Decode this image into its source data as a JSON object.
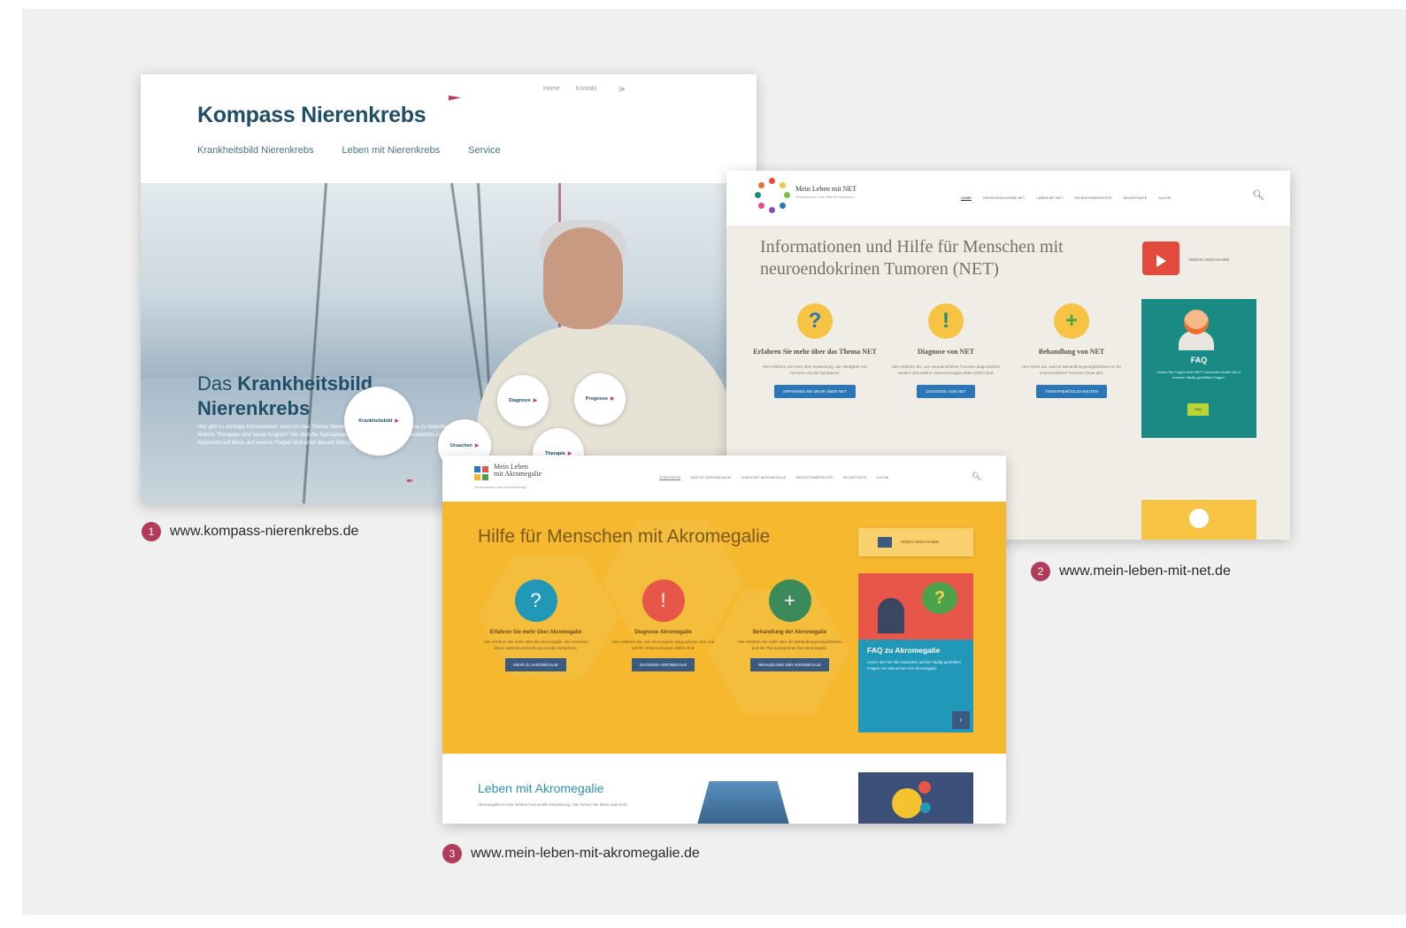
{
  "shot1": {
    "logo": "Kompass Nierenkrebs",
    "topnav": [
      "Home",
      "Kontakt"
    ],
    "mainnav": [
      "Krankheitsbild Nierenkrebs",
      "Leben mit Nierenkrebs",
      "Service"
    ],
    "headline_light": "Das",
    "headline_bold1": "Krankheitsbild",
    "headline_bold2": "Nierenkrebs",
    "lead": "Hier gibt es wichtige Informationen rund um das Thema Nierenkrebs. Was ist bei der Diagnose zu beachten? Welche Therapien sind heute möglich? Wo sind die Spezialisten für die Behandlung von Nierenkrebs zu finden? Antworten auf diese und weitere Fragen sind unter diesem Menüpunkt nachzulesen.",
    "bubbles": [
      "Krankheitsbild",
      "Diagnose",
      "Prognose",
      "Ursachen",
      "Therapie"
    ]
  },
  "shot2": {
    "logo": "Mein Leben mit NET",
    "logo_sub": "Informationen und Hilfe für Menschen",
    "nav": [
      "HOME",
      "NEUROENDOKRINE NET",
      "LEBEN MIT NET",
      "PATIENTENBERICHTE",
      "SELBSTHILFE",
      "SUCHE"
    ],
    "title": "Informationen und Hilfe für Menschen mit neuroendokrinen Tumoren (NET)",
    "video_label": "VIDEOS ANSCHAUEN",
    "columns": [
      {
        "icon": "?",
        "heading": "Erfahren Sie mehr über das Thema NET",
        "text": "Hier erfahren Sie mehr über Entstehung, die Häufigkeit von Tumoren und die Symptome.",
        "button": "ERFAHREN SIE MEHR ÜBER NET"
      },
      {
        "icon": "!",
        "heading": "Diagnose von NET",
        "text": "Hier erfahren Sie, wie neuroendokrine Tumoren diagnostiziert werden und welche Untersuchungen dabei üblich sind.",
        "button": "DIAGNOSE VON NET"
      },
      {
        "icon": "+",
        "heading": "Behandlung von NET",
        "text": "Hier lesen Sie, welche Behandlungsmöglichkeiten es für neuroendokrine Tumoren heute gibt.",
        "button": "THERAPIEMÖGLICHKEITEN"
      }
    ],
    "faq_title": "FAQ",
    "faq_text": "Haben Sie Fragen über NET? Antworten finden Sie in unseren häufig gestellten Fragen.",
    "faq_button": "FAQ"
  },
  "shot3": {
    "logo_line1": "Mein Leben",
    "logo_line2": "mit Akromegalie",
    "logo_sub": "Informationen und Unterstützung",
    "nav": [
      "STARTSEITE",
      "WAS IST AKROMEGALIE",
      "LEBEN MIT AKROMEGALIE",
      "PATIENTENBERICHTE",
      "SELBSTHILFE",
      "SUCHE"
    ],
    "title": "Hilfe für Menschen mit Akromegalie",
    "video_label": "VIDEO ANSCHAUEN",
    "columns": [
      {
        "icon": "?",
        "heading": "Erfahren Sie mehr über Akromegalie",
        "text": "Hier erfahren Sie mehr über die Akromegalie, die Ursachen dieser seltenen Erkrankung und die Symptome.",
        "button": "MEHR ZU AKROMEGALIE"
      },
      {
        "icon": "!",
        "heading": "Diagnose Akromegalie",
        "text": "Hier erfahren Sie, wie Akromegalie diagnostiziert wird und welche Untersuchungen üblich sind.",
        "button": "DIAGNOSE AKROMEGALIE"
      },
      {
        "icon": "+",
        "heading": "Behandlung der Akromegalie",
        "text": "Hier erfahren Sie mehr über die Behandlungsmöglichkeiten und die Therapieoptionen bei Akromegalie.",
        "button": "BEHANDLUNG DER AKROMEGALIE"
      }
    ],
    "faq_title": "FAQ zu Akromegalie",
    "faq_text": "Lesen Sie hier die Antworten auf die häufig gestellten Fragen von Menschen mit Akromegalie.",
    "section_title": "Leben mit Akromegalie",
    "section_text": "Akromegalie ist eine seltene hormonelle Erkrankung. Hier lernen Sie leben und mehr."
  },
  "captions": [
    {
      "number": "1",
      "url": "www.kompass-nierenkrebs.de"
    },
    {
      "number": "2",
      "url": "www.mein-leben-mit-net.de"
    },
    {
      "number": "3",
      "url": "www.mein-leben-mit-akromegalie.de"
    }
  ],
  "colors": {
    "panel": "#f0f0f0",
    "accent_number": "#b23a5a",
    "kompass_blue": "#1f4f66",
    "net_teal": "#1a8a84",
    "akro_yellow": "#f5b82e"
  }
}
